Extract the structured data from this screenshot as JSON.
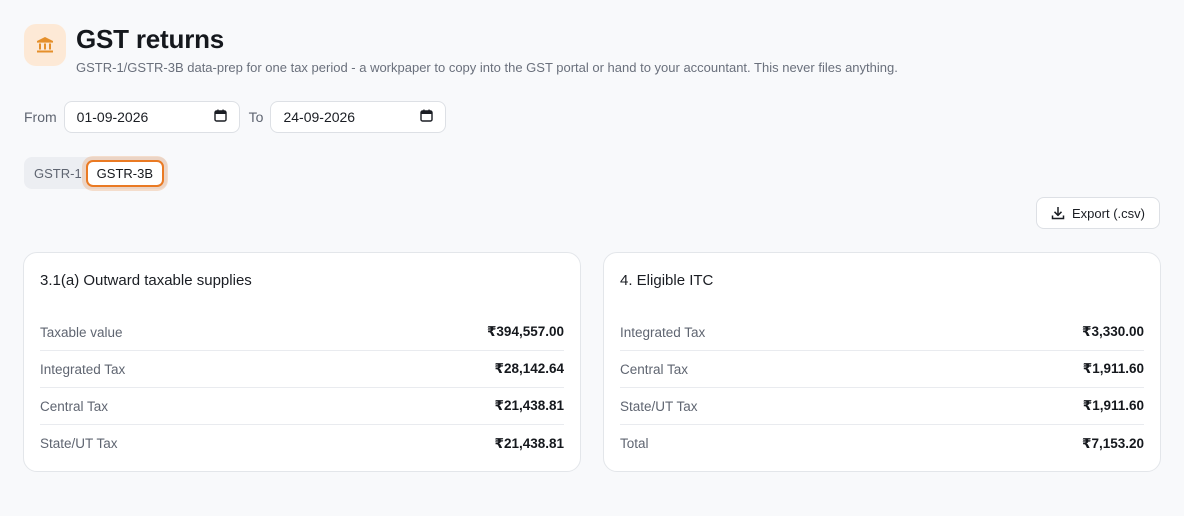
{
  "header": {
    "title": "GST returns",
    "subtitle": "GSTR-1/GSTR-3B data-prep for one tax period - a workpaper to copy into the GST portal or hand to your accountant. This never files anything.",
    "icon": "bank-icon",
    "accent_color": "#ea7a23"
  },
  "date_range": {
    "from_label": "From",
    "from_value": "01-09-2026",
    "to_label": "To",
    "to_value": "24-09-2026"
  },
  "tabs": [
    {
      "label": "GSTR-1",
      "active": false
    },
    {
      "label": "GSTR-3B",
      "active": true
    }
  ],
  "export": {
    "label": "Export (.csv)"
  },
  "cards": [
    {
      "title": "3.1(a) Outward taxable supplies",
      "rows": [
        {
          "label": "Taxable value",
          "value": "₹394,557.00"
        },
        {
          "label": "Integrated Tax",
          "value": "₹28,142.64"
        },
        {
          "label": "Central Tax",
          "value": "₹21,438.81"
        },
        {
          "label": "State/UT Tax",
          "value": "₹21,438.81"
        }
      ]
    },
    {
      "title": "4. Eligible ITC",
      "rows": [
        {
          "label": "Integrated Tax",
          "value": "₹3,330.00"
        },
        {
          "label": "Central Tax",
          "value": "₹1,911.60"
        },
        {
          "label": "State/UT Tax",
          "value": "₹1,911.60"
        },
        {
          "label": "Total",
          "value": "₹7,153.20"
        }
      ]
    }
  ]
}
